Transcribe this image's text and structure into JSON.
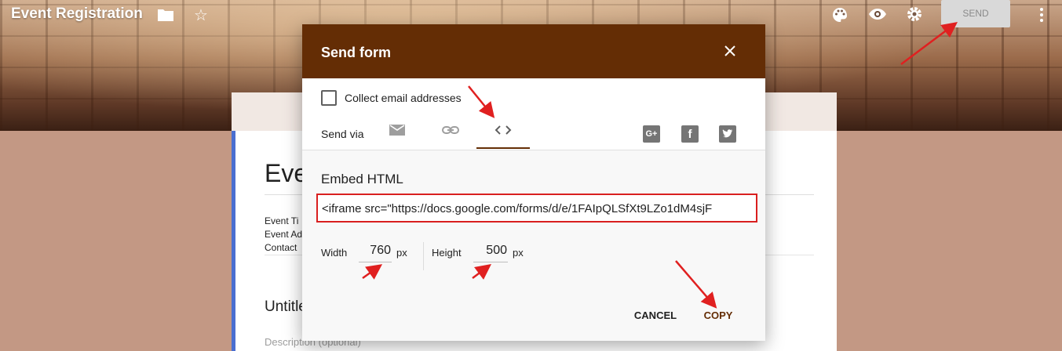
{
  "app": {
    "title": "Event Registration",
    "send_label": "SEND"
  },
  "form": {
    "title": "Eve",
    "description_lines": [
      "Event Ti",
      "Event Ad",
      "Contact"
    ],
    "section_title": "Untitle",
    "section_description": "Description (optional)"
  },
  "dialog": {
    "title": "Send form",
    "collect_email_label": "Collect email addresses",
    "collect_email_checked": false,
    "send_via_label": "Send via",
    "tabs": [
      "email-icon",
      "link-icon",
      "embed-code-icon"
    ],
    "active_tab": "embed-code-icon",
    "share": [
      "google-plus-icon",
      "facebook-icon",
      "twitter-icon"
    ],
    "gplus_glyph": "G+",
    "fb_glyph": "f",
    "embed_label": "Embed HTML",
    "embed_code": "<iframe src=\"https://docs.google.com/forms/d/e/1FAIpQLSfXt9LZo1dM4sjF",
    "width_label": "Width",
    "width_value": "760",
    "width_unit": "px",
    "height_label": "Height",
    "height_value": "500",
    "height_unit": "px",
    "cancel_label": "CANCEL",
    "copy_label": "COPY"
  },
  "colors": {
    "header_bg": "#642d05",
    "annotation_red": "#e02020",
    "embed_border": "#d91f1f",
    "page_bg": "#c39884"
  }
}
